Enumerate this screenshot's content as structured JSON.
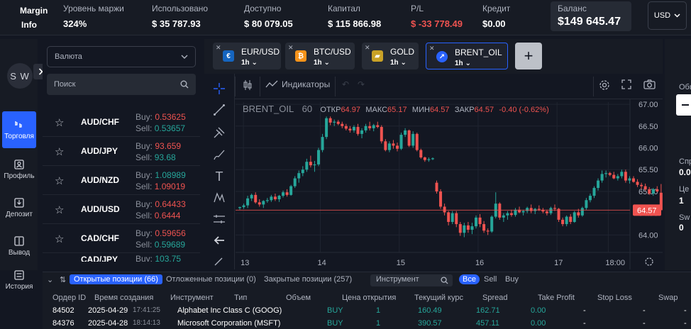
{
  "topbar": {
    "margin_info_line1": "Margin",
    "margin_info_line2": "Info",
    "stats": [
      {
        "label": "Уровень маржи",
        "value": "324%"
      },
      {
        "label": "Использовано",
        "value": "$ 35 787.93"
      },
      {
        "label": "Доступно",
        "value": "$ 80 079.05"
      },
      {
        "label": "Капитал",
        "value": "$ 115 866.98"
      },
      {
        "label": "P/L",
        "value": "$ -33 778.49"
      },
      {
        "label": "Кредит",
        "value": "$0.00"
      }
    ],
    "balance": {
      "label": "Баланс",
      "value": "$149 645.47"
    },
    "currency": "USD"
  },
  "leftnav": {
    "avatar": "S W",
    "items": [
      {
        "label": "Торговля"
      },
      {
        "label": "Профиль"
      },
      {
        "label": "Депозит"
      },
      {
        "label": "Вывод"
      },
      {
        "label": "История"
      }
    ]
  },
  "instruments": {
    "category_select": "Валюта",
    "search_placeholder": "Поиск",
    "buy_label": "Buy:",
    "sell_label": "Sell:",
    "items": [
      {
        "symbol": "AUD/CHF",
        "buy": "0.53625",
        "sell": "0.53657"
      },
      {
        "symbol": "AUD/JPY",
        "buy": "93.659",
        "sell": "93.68"
      },
      {
        "symbol": "AUD/NZD",
        "buy": "1.08989",
        "sell": "1.09019"
      },
      {
        "symbol": "AUD/USD",
        "buy": "0.64433",
        "sell": "0.6444"
      },
      {
        "symbol": "CAD/CHF",
        "buy": "0.59656",
        "sell": "0.59689"
      },
      {
        "symbol": "CAD/JPY",
        "buy": "103.75",
        "sell": ""
      }
    ]
  },
  "tabs": [
    {
      "name": "EUR/USD",
      "timeframe": "1h"
    },
    {
      "name": "BTC/USD",
      "timeframe": "1h"
    },
    {
      "name": "GOLD",
      "timeframe": "1h"
    },
    {
      "name": "BRENT_OIL",
      "timeframe": "1h"
    }
  ],
  "chart_toolbar": {
    "indicators": "Индикаторы"
  },
  "legend": {
    "symbol": "BRENT_OIL",
    "interval": "60",
    "open_label": "ОТКР",
    "open": "64.97",
    "high_label": "МАКС",
    "high": "65.17",
    "low_label": "МИН",
    "low": "64.57",
    "close_label": "ЗАКР",
    "close": "64.57",
    "change": "-0.40 (-0.62%)"
  },
  "chart_data": {
    "type": "candlestick",
    "x_ticks": [
      "13",
      "14",
      "15",
      "16",
      "17",
      "18:00"
    ],
    "y_ticks": [
      64.0,
      64.5,
      65.0,
      65.5,
      66.0,
      66.5,
      67.0
    ],
    "ylim": [
      63.6,
      67.05
    ],
    "last_price": "64.57",
    "candles": [
      [
        64.62,
        64.65,
        64.58,
        64.64
      ],
      [
        64.64,
        64.72,
        64.6,
        64.68
      ],
      [
        64.68,
        64.9,
        64.62,
        64.84
      ],
      [
        64.84,
        64.95,
        64.78,
        64.92
      ],
      [
        64.92,
        64.98,
        64.72,
        64.75
      ],
      [
        64.75,
        64.82,
        64.65,
        64.7
      ],
      [
        64.7,
        64.8,
        64.62,
        64.78
      ],
      [
        64.78,
        64.85,
        64.74,
        64.8
      ],
      [
        64.8,
        64.92,
        64.76,
        64.88
      ],
      [
        64.88,
        64.95,
        64.78,
        64.82
      ],
      [
        64.82,
        64.92,
        64.76,
        64.9
      ],
      [
        64.9,
        65.02,
        64.86,
        64.98
      ],
      [
        64.98,
        65.05,
        64.88,
        64.92
      ],
      [
        64.92,
        65.15,
        64.9,
        65.12
      ],
      [
        65.12,
        65.35,
        65.08,
        65.3
      ],
      [
        65.3,
        65.48,
        65.2,
        65.42
      ],
      [
        65.42,
        65.58,
        65.35,
        65.5
      ],
      [
        65.5,
        65.75,
        65.45,
        65.68
      ],
      [
        65.68,
        65.82,
        65.55,
        65.6
      ],
      [
        65.6,
        65.7,
        65.45,
        65.62
      ],
      [
        65.62,
        66.0,
        65.58,
        65.95
      ],
      [
        65.95,
        66.32,
        65.9,
        66.25
      ],
      [
        66.25,
        66.72,
        66.2,
        66.68
      ],
      [
        66.68,
        66.72,
        66.52,
        66.58
      ],
      [
        66.58,
        66.65,
        66.5,
        66.6
      ],
      [
        66.6,
        66.64,
        66.52,
        66.55
      ],
      [
        66.55,
        66.6,
        66.45,
        66.5
      ],
      [
        66.5,
        66.55,
        66.4,
        66.44
      ],
      [
        66.44,
        66.5,
        66.35,
        66.4
      ],
      [
        66.4,
        66.52,
        66.35,
        66.48
      ],
      [
        66.48,
        66.55,
        66.28,
        66.32
      ],
      [
        66.32,
        66.45,
        66.22,
        66.4
      ],
      [
        66.4,
        66.55,
        66.35,
        66.5
      ],
      [
        66.5,
        66.6,
        66.4,
        66.45
      ],
      [
        66.45,
        66.55,
        66.38,
        66.52
      ],
      [
        66.52,
        66.6,
        66.45,
        66.48
      ],
      [
        66.48,
        66.52,
        66.1,
        66.15
      ],
      [
        66.15,
        66.2,
        65.92,
        65.95
      ],
      [
        65.95,
        66.15,
        65.9,
        66.1
      ],
      [
        66.1,
        66.18,
        65.98,
        66.05
      ],
      [
        66.05,
        66.12,
        65.92,
        65.98
      ],
      [
        65.98,
        66.35,
        65.95,
        66.3
      ],
      [
        66.3,
        66.45,
        66.25,
        66.4
      ],
      [
        66.4,
        66.42,
        66.02,
        66.05
      ],
      [
        66.05,
        66.38,
        66.0,
        66.32
      ],
      [
        66.32,
        66.35,
        65.92,
        65.95
      ],
      [
        65.95,
        65.98,
        65.75,
        65.78
      ],
      [
        65.78,
        65.8,
        65.68,
        65.72
      ],
      [
        65.72,
        65.78,
        65.68,
        65.74
      ],
      [
        65.74,
        65.78,
        65.72,
        65.76
      ],
      [
        65.2,
        65.25,
        64.95,
        65.0
      ],
      [
        65.0,
        65.05,
        64.6,
        64.65
      ],
      [
        64.65,
        64.72,
        64.45,
        64.52
      ],
      [
        64.52,
        64.55,
        64.22,
        64.3
      ],
      [
        64.3,
        64.55,
        64.25,
        64.5
      ],
      [
        64.5,
        64.55,
        64.18,
        64.25
      ],
      [
        64.25,
        64.3,
        63.98,
        64.05
      ],
      [
        64.05,
        64.28,
        63.95,
        64.22
      ],
      [
        64.22,
        64.3,
        64.05,
        64.12
      ],
      [
        64.12,
        64.28,
        64.02,
        64.2
      ],
      [
        64.2,
        64.45,
        64.15,
        64.4
      ],
      [
        64.4,
        64.48,
        64.18,
        64.25
      ],
      [
        64.25,
        64.32,
        64.05,
        64.1
      ],
      [
        64.1,
        64.15,
        64.0,
        64.08
      ],
      [
        64.08,
        64.45,
        64.05,
        64.42
      ],
      [
        64.42,
        64.98,
        64.38,
        64.72
      ],
      [
        64.72,
        64.75,
        64.35,
        64.4
      ],
      [
        64.4,
        64.5,
        64.3,
        64.45
      ],
      [
        64.45,
        64.55,
        64.35,
        64.5
      ],
      [
        64.5,
        64.58,
        64.42,
        64.46
      ],
      [
        64.46,
        64.62,
        64.42,
        64.58
      ],
      [
        64.58,
        64.65,
        64.5,
        64.52
      ],
      [
        64.52,
        64.58,
        64.45,
        64.55
      ],
      [
        64.55,
        64.65,
        64.5,
        64.62
      ],
      [
        64.62,
        64.7,
        64.5,
        64.55
      ],
      [
        64.55,
        64.62,
        64.48,
        64.6
      ],
      [
        64.6,
        64.68,
        64.55,
        64.58
      ],
      [
        64.58,
        64.62,
        64.5,
        64.54
      ],
      [
        64.54,
        64.58,
        64.45,
        64.5
      ],
      [
        64.5,
        64.65,
        64.46,
        64.62
      ],
      [
        64.62,
        64.7,
        64.55,
        64.6
      ],
      [
        64.6,
        64.62,
        64.3,
        64.35
      ],
      [
        64.35,
        64.4,
        64.2,
        64.25
      ],
      [
        64.25,
        64.45,
        64.2,
        64.42
      ],
      [
        64.42,
        64.48,
        64.25,
        64.3
      ],
      [
        64.3,
        64.55,
        64.28,
        64.52
      ],
      [
        64.52,
        64.6,
        64.4,
        64.45
      ],
      [
        64.45,
        64.65,
        64.42,
        64.62
      ],
      [
        64.62,
        64.85,
        64.58,
        64.8
      ],
      [
        64.8,
        64.95,
        64.75,
        64.9
      ],
      [
        64.9,
        65.12,
        64.85,
        65.08
      ],
      [
        65.08,
        65.3,
        65.02,
        65.25
      ],
      [
        65.25,
        65.48,
        65.2,
        65.4
      ],
      [
        65.4,
        65.48,
        65.32,
        65.42
      ],
      [
        65.42,
        65.45,
        65.35,
        65.38
      ],
      [
        65.38,
        65.45,
        65.28,
        65.3
      ],
      [
        65.3,
        65.4,
        65.25,
        65.35
      ],
      [
        65.35,
        65.5,
        65.3,
        65.45
      ],
      [
        65.45,
        65.5,
        65.2,
        65.25
      ],
      [
        65.25,
        65.35,
        65.18,
        65.3
      ],
      [
        65.3,
        65.35,
        65.2,
        65.22
      ],
      [
        65.22,
        65.28,
        65.1,
        65.15
      ],
      [
        65.15,
        65.2,
        65.05,
        65.12
      ],
      [
        65.12,
        65.18,
        65.02,
        65.05
      ],
      [
        65.05,
        65.1,
        64.92,
        64.95
      ],
      [
        64.95,
        65.08,
        64.9,
        65.05
      ],
      [
        65.05,
        65.12,
        64.98,
        65.0
      ],
      [
        64.97,
        65.17,
        64.57,
        64.57
      ]
    ]
  },
  "bottom": {
    "tabs": [
      "Открытые позиции (66)",
      "Отложенные позиции (0)",
      "Закрытые позиции (257)"
    ],
    "instrument_placeholder": "Инструмент",
    "filters": [
      "Все",
      "Sell",
      "Buy"
    ],
    "columns": [
      "Ордер ID",
      "Время создания",
      "Инструмент",
      "Тип",
      "Объем",
      "Цена открытия",
      "Текущий курс",
      "Spread",
      "Take Profit",
      "Stop Loss",
      "Swap"
    ],
    "rows": [
      {
        "id": "84502",
        "date": "2025-04-29",
        "time": "17:41:25",
        "instrument": "Alphabet Inc Class C (GOOG)",
        "type": "BUY",
        "volume": "1",
        "open": "160.49",
        "current": "162.71",
        "spread": "0.00",
        "tp": "-",
        "sl": "-",
        "swap": "-"
      },
      {
        "id": "84376",
        "date": "2025-04-28",
        "time": "18:14:13",
        "instrument": "Microsoft Corporation (MSFT)",
        "type": "BUY",
        "volume": "1",
        "open": "390.57",
        "current": "457.11",
        "spread": "0.00",
        "tp": "-",
        "sl": "-",
        "swap": "-"
      }
    ]
  },
  "rightpanel": {
    "labels": [
      "Обы",
      "Спр",
      "0.0",
      "Це",
      "1",
      "Sw",
      "0"
    ]
  }
}
